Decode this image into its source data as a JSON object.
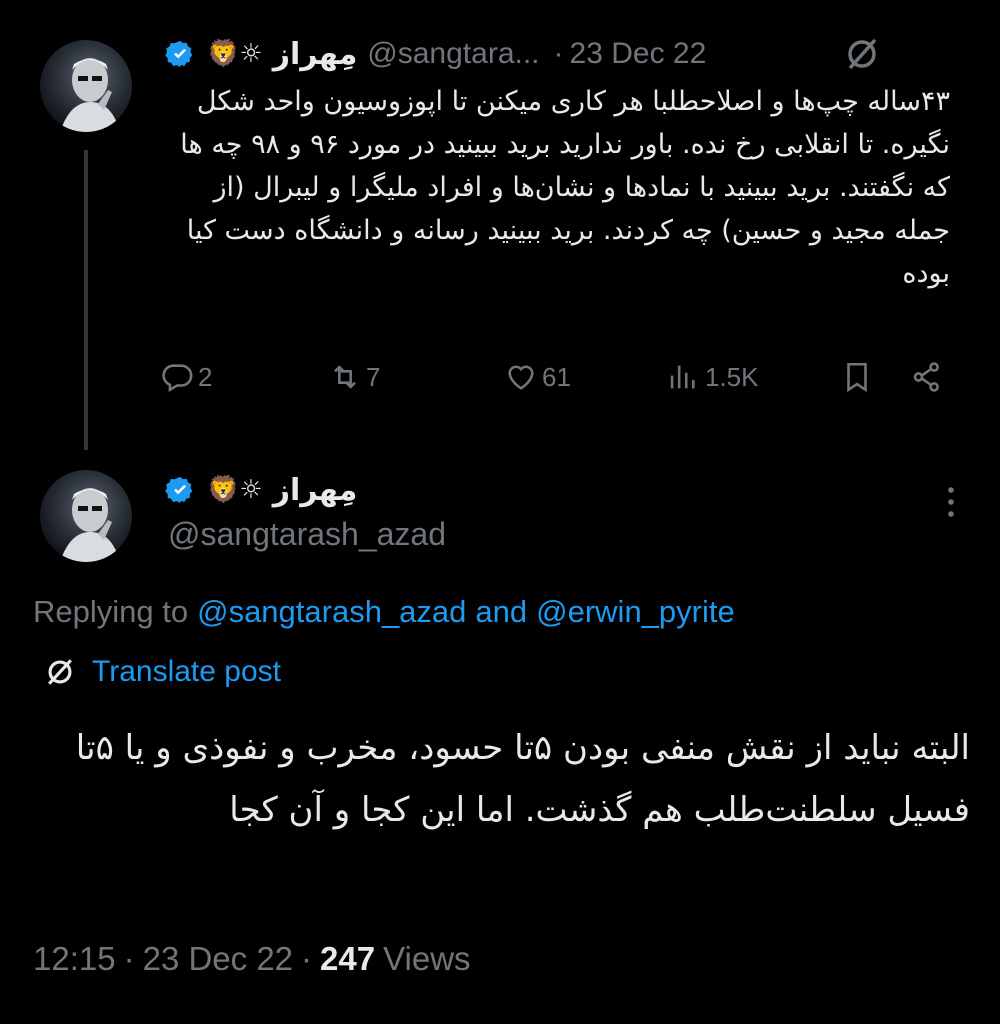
{
  "tweet1": {
    "display_name": "مِهراز",
    "emoji_badges": "🦁☼",
    "handle": "@sangtara...",
    "separator": "·",
    "date": "23 Dec 22",
    "text": "۴۳ساله چپ‌ها و اصلاحطلبا هر کاری میکنن تا اپوزوسیون واحد شکل نگیره. تا انقلابی رخ نده. باور ندارید برید ببینید در مورد ۹۶ و ۹۸ چه ها که نگفتند. برید ببینید با نمادها و نشان‌ها و افراد ملیگرا و لیبرال (از جمله مجید و حسین) چه کردند. برید ببینید رسانه و دانشگاه دست کیا بوده",
    "actions": {
      "replies": "2",
      "reposts": "7",
      "likes": "61",
      "views": "1.5K"
    }
  },
  "tweet2": {
    "display_name": "مِهراز",
    "emoji_badges": "🦁☼",
    "handle": "@sangtarash_azad",
    "replying_prefix": "Replying to",
    "replying_user1": "@sangtarash_azad",
    "replying_and": "and",
    "replying_user2": "@erwin_pyrite",
    "translate_label": "Translate post",
    "text": "البته نباید از نقش منفی بودن ۵تا حسود، مخرب و نفوذی و یا ۵تا فسیل سلطنت‌طلب هم گذشت. اما این کجا و آن کجا",
    "time": "12:15",
    "separator": "·",
    "date": "23 Dec 22",
    "views_count": "247",
    "views_label": "Views"
  },
  "colors": {
    "background": "#000000",
    "text": "#e7e9ea",
    "muted": "#71767b",
    "link": "#1d9bf0",
    "verified": "#1d9bf0"
  }
}
